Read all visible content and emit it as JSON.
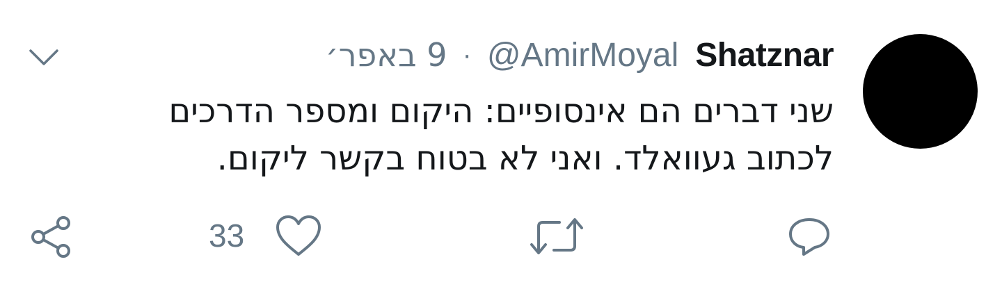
{
  "tweet": {
    "author_name": "Shatznar",
    "handle": "@AmirMoyal",
    "separator": "·",
    "timestamp": "9 באפר׳",
    "text_lines": [
      "שני דברים הם אינסופיים: היקום ומספר הדרכים",
      "לכתוב געוואלד. ואני לא בטוח בקשר ליקום."
    ],
    "like_count": "33"
  },
  "icons": {
    "avatar": "avatar-circle",
    "caret": "chevron-down-icon",
    "reply": "reply-icon",
    "retweet": "retweet-icon",
    "like": "heart-icon",
    "share": "share-icon"
  },
  "colors": {
    "text": "#14171a",
    "secondary": "#657786",
    "avatar": "#000000",
    "background": "#ffffff"
  }
}
